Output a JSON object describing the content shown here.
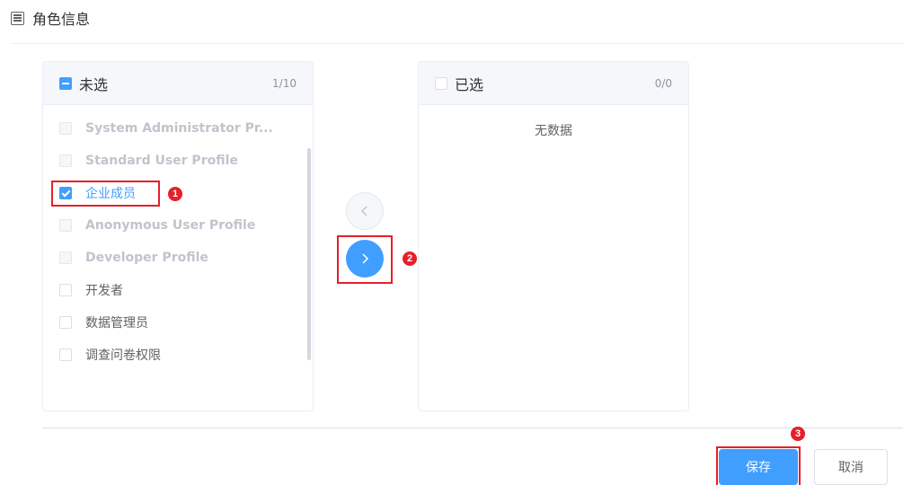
{
  "section": {
    "title": "角色信息",
    "icon": "list-icon"
  },
  "left_panel": {
    "title": "未选",
    "count": "1/10",
    "items": [
      {
        "label": "System Administrator Pr...",
        "state": "disabled"
      },
      {
        "label": "Standard User Profile",
        "state": "disabled"
      },
      {
        "label": "企业成员",
        "state": "checked"
      },
      {
        "label": "Anonymous User Profile",
        "state": "disabled"
      },
      {
        "label": "Developer Profile",
        "state": "disabled"
      },
      {
        "label": "开发者",
        "state": "unchecked"
      },
      {
        "label": "数据管理员",
        "state": "unchecked"
      },
      {
        "label": "调查问卷权限",
        "state": "unchecked"
      }
    ]
  },
  "right_panel": {
    "title": "已选",
    "count": "0/0",
    "empty_text": "无数据"
  },
  "transfer": {
    "left_icon": "chevron-left-icon",
    "right_icon": "chevron-right-icon"
  },
  "callouts": [
    "1",
    "2",
    "3"
  ],
  "actions": {
    "save_label": "保存",
    "cancel_label": "取消"
  },
  "colors": {
    "primary": "#409eff",
    "callout": "#e5202a"
  }
}
